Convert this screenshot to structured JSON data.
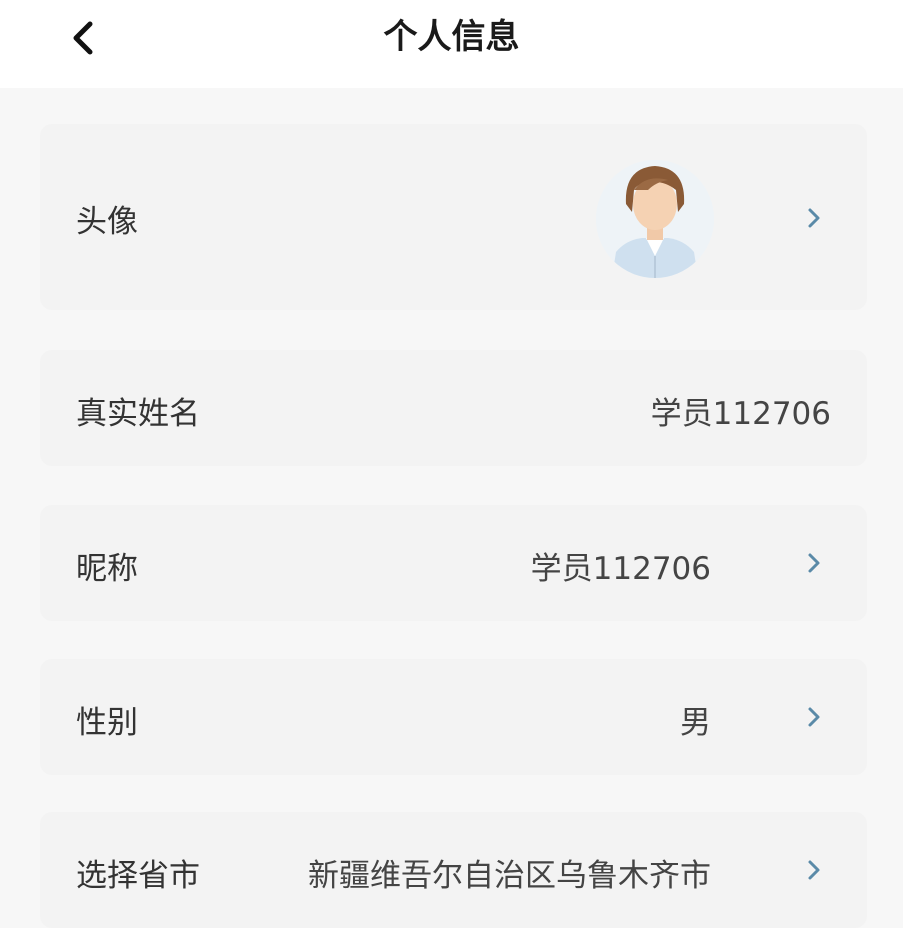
{
  "header": {
    "title": "个人信息",
    "back_icon": "chevron-left-icon"
  },
  "rows": [
    {
      "label": "头像",
      "value": "",
      "has_avatar": true,
      "has_chevron": true
    },
    {
      "label": "真实姓名",
      "value": "学员112706",
      "has_chevron": false
    },
    {
      "label": "昵称",
      "value": "学员112706",
      "has_chevron": true
    },
    {
      "label": "性别",
      "value": "男",
      "has_chevron": true
    },
    {
      "label": "选择省市",
      "value": "新疆维吾尔自治区乌鲁木齐市",
      "has_chevron": true
    }
  ],
  "colors": {
    "background": "#f7f7f7",
    "card": "#f3f3f3",
    "chevron": "#5a8aa8",
    "text": "#333333"
  }
}
